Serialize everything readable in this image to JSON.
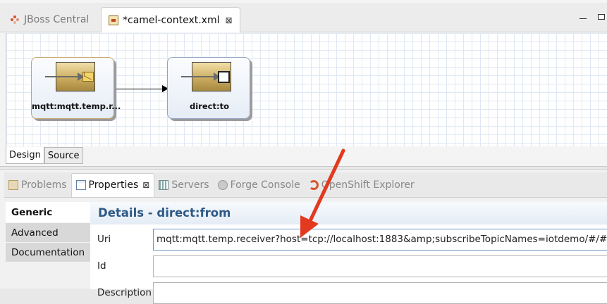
{
  "editor": {
    "tabs": [
      {
        "label": "JBoss Central",
        "icon": "jboss-central-icon",
        "active": false
      },
      {
        "label": "*camel-context.xml",
        "icon": "xml-file-icon",
        "active": true,
        "close": "⊠"
      }
    ],
    "nodes": [
      {
        "label": "mqtt:mqtt.temp.r...",
        "icon": "mqtt-endpoint-icon"
      },
      {
        "label": "direct:to",
        "icon": "direct-endpoint-icon"
      }
    ],
    "subtabs": [
      "Design",
      "Source"
    ]
  },
  "views": {
    "tabs": [
      {
        "label": "Problems",
        "icon": "problems-icon",
        "active": false
      },
      {
        "label": "Properties",
        "icon": "properties-icon",
        "active": true,
        "close": "⊠"
      },
      {
        "label": "Servers",
        "icon": "servers-icon",
        "active": false
      },
      {
        "label": "Forge Console",
        "icon": "forge-console-icon",
        "active": false
      },
      {
        "label": "OpenShift Explorer",
        "icon": "openshift-icon",
        "active": false
      }
    ],
    "nav": [
      "Generic",
      "Advanced",
      "Documentation"
    ],
    "details": {
      "title": "Details - direct:from",
      "fields": [
        {
          "label": "Uri",
          "value": "mqtt:mqtt.temp.receiver?host=tcp://localhost:1883&amp;subscribeTopicNames=iotdemo/#/#&am"
        },
        {
          "label": "Id",
          "value": ""
        },
        {
          "label": "Description",
          "value": ""
        }
      ]
    }
  },
  "colors": {
    "annotation_arrow": "#e2391f",
    "details_title": "#2f5a86"
  }
}
